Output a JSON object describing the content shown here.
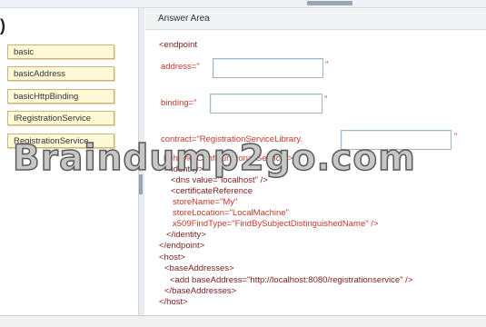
{
  "left_paren": ")",
  "answer_area_title": "Answer Area",
  "drag_items": [
    {
      "label": "basic"
    },
    {
      "label": "basicAddress"
    },
    {
      "label": "basicHttpBinding"
    },
    {
      "label": "IRegistrationService"
    },
    {
      "label": "RegistrationService"
    }
  ],
  "code": {
    "endpoint_open": "<endpoint",
    "address_attr": "address=\"",
    "binding_attr": "binding=\"",
    "contract_attr": "contract=\"RegistrationServiceLibrary.",
    "quote": "\"",
    "identity_line_1": "behaviorConfiguration=\"Service\">",
    "identity_line_2": "<identity>",
    "dns_line": "<dns value=\"localhost\" />",
    "cert_ref": "<certificateReference",
    "store_name": "storeName=\"My\"",
    "store_location": "storeLocation=\"LocalMachine\"",
    "find_type": "x509FindType=\"FindBySubjectDistinguishedName\" />",
    "identity_close": "</identity>",
    "endpoint_close": "</endpoint>",
    "host_open": "<host>",
    "base_addresses_open": "<baseAddresses>",
    "add_base_address": "<add baseAddress=\"http://localhost:8080/registrationservice\" />",
    "base_addresses_close": "</baseAddresses>",
    "host_close": "</host>"
  },
  "watermark": "Braindump2go.com",
  "colors": {
    "item_fill": "#fff9d8",
    "item_border": "#c9b67a",
    "tag_color": "#7a1c1c",
    "attr_color": "#c0392b",
    "drop_border": "#9fb6cc"
  }
}
